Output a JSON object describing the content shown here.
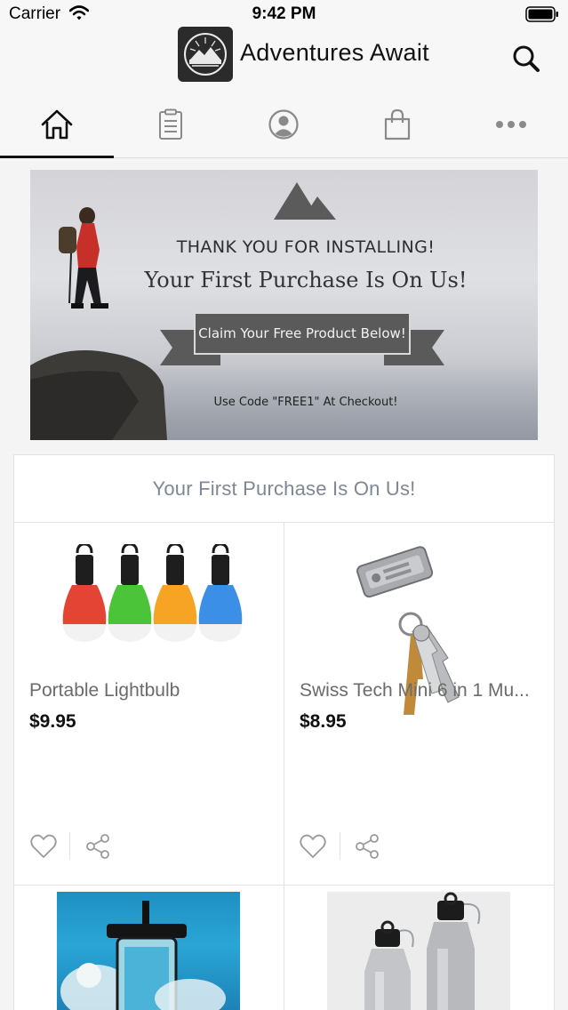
{
  "status_bar": {
    "carrier": "Carrier",
    "time": "9:42 PM"
  },
  "header": {
    "title": "Adventures Await",
    "logo_icon": "mountain-badge-logo",
    "search_icon": "search-icon"
  },
  "tabs": [
    {
      "icon": "home-icon",
      "active": true
    },
    {
      "icon": "clipboard-icon",
      "active": false
    },
    {
      "icon": "profile-icon",
      "active": false
    },
    {
      "icon": "shopping-bag-icon",
      "active": false
    },
    {
      "icon": "more-icon",
      "active": false
    }
  ],
  "banner": {
    "thanks": "THANK YOU FOR INSTALLING!",
    "headline": "Your First Purchase Is On Us!",
    "claim_label": "Claim Your Free Product Below!",
    "code_text": "Use Code \"FREE1\" At Checkout!"
  },
  "collection": {
    "title": "Your First Purchase Is On Us!",
    "products": [
      {
        "name": "Portable Lightbulb",
        "price": "$9.95"
      },
      {
        "name": "Swiss Tech Mini 6 in 1 Mu...",
        "price": "$8.95"
      }
    ]
  },
  "colors": {
    "accent": "#111111",
    "tab_icon": "#8a8a8a",
    "title_gray": "#7e8794"
  }
}
